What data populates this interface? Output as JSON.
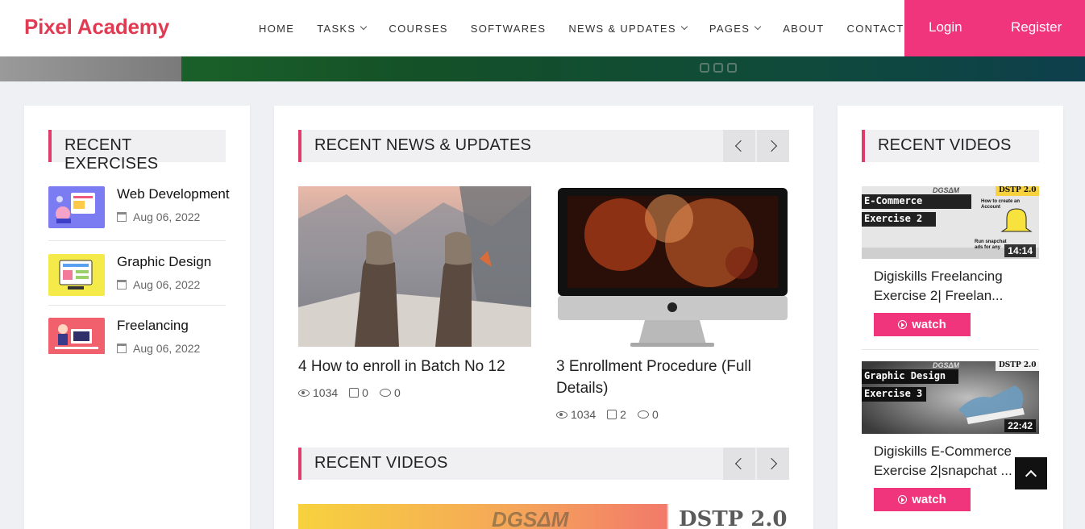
{
  "header": {
    "logo": "Pixel Academy",
    "nav": [
      {
        "label": "HOME",
        "dropdown": false
      },
      {
        "label": "TASKS",
        "dropdown": true
      },
      {
        "label": "COURSES",
        "dropdown": false
      },
      {
        "label": "SOFTWARES",
        "dropdown": false
      },
      {
        "label": "NEWS & UPDATES",
        "dropdown": true
      },
      {
        "label": "PAGES",
        "dropdown": true
      },
      {
        "label": "ABOUT",
        "dropdown": false
      },
      {
        "label": "CONTACT",
        "dropdown": false
      }
    ],
    "login": "Login",
    "register": "Register"
  },
  "left": {
    "heading": "RECENT EXERCISES",
    "items": [
      {
        "title": "Web Development",
        "date": "Aug 06, 2022"
      },
      {
        "title": "Graphic Design",
        "date": "Aug 06, 2022"
      },
      {
        "title": "Freelancing",
        "date": "Aug 06, 2022"
      }
    ]
  },
  "middle": {
    "news_heading": "RECENT NEWS & UPDATES",
    "news": [
      {
        "title": "4 How to enroll in Batch No 12",
        "views": "1034",
        "likes": "0",
        "comments": "0"
      },
      {
        "title": "3 Enrollment Procedure (Full Details)",
        "views": "1034",
        "likes": "2",
        "comments": "0"
      }
    ],
    "videos_heading": "RECENT VIDEOS",
    "video_banner": {
      "brand": "DGSΔM",
      "tag": "DSTP 2.0"
    }
  },
  "right": {
    "heading": "RECENT VIDEOS",
    "videos": [
      {
        "title": "Digiskills Freelancing Exercise 2| Freelan...",
        "duration": "14:14",
        "thumb_line1": "E-Commerce",
        "thumb_line2": "Exercise 2",
        "brand": "DGSΔM",
        "tag": "DSTP 2.0",
        "side_text": "How to create an Account",
        "side_text2": "Run snapchat ads for any"
      },
      {
        "title": "Digiskills E-Commerce Exercise 2|snapchat ...",
        "duration": "22:42",
        "thumb_line1": "Graphic Design",
        "thumb_line2": "Exercise 3",
        "brand": "DGSΔM",
        "tag": "DSTP 2.0"
      }
    ],
    "watch_label": "watch"
  },
  "colors": {
    "brand": "#e03b53",
    "accent": "#f0357d"
  }
}
